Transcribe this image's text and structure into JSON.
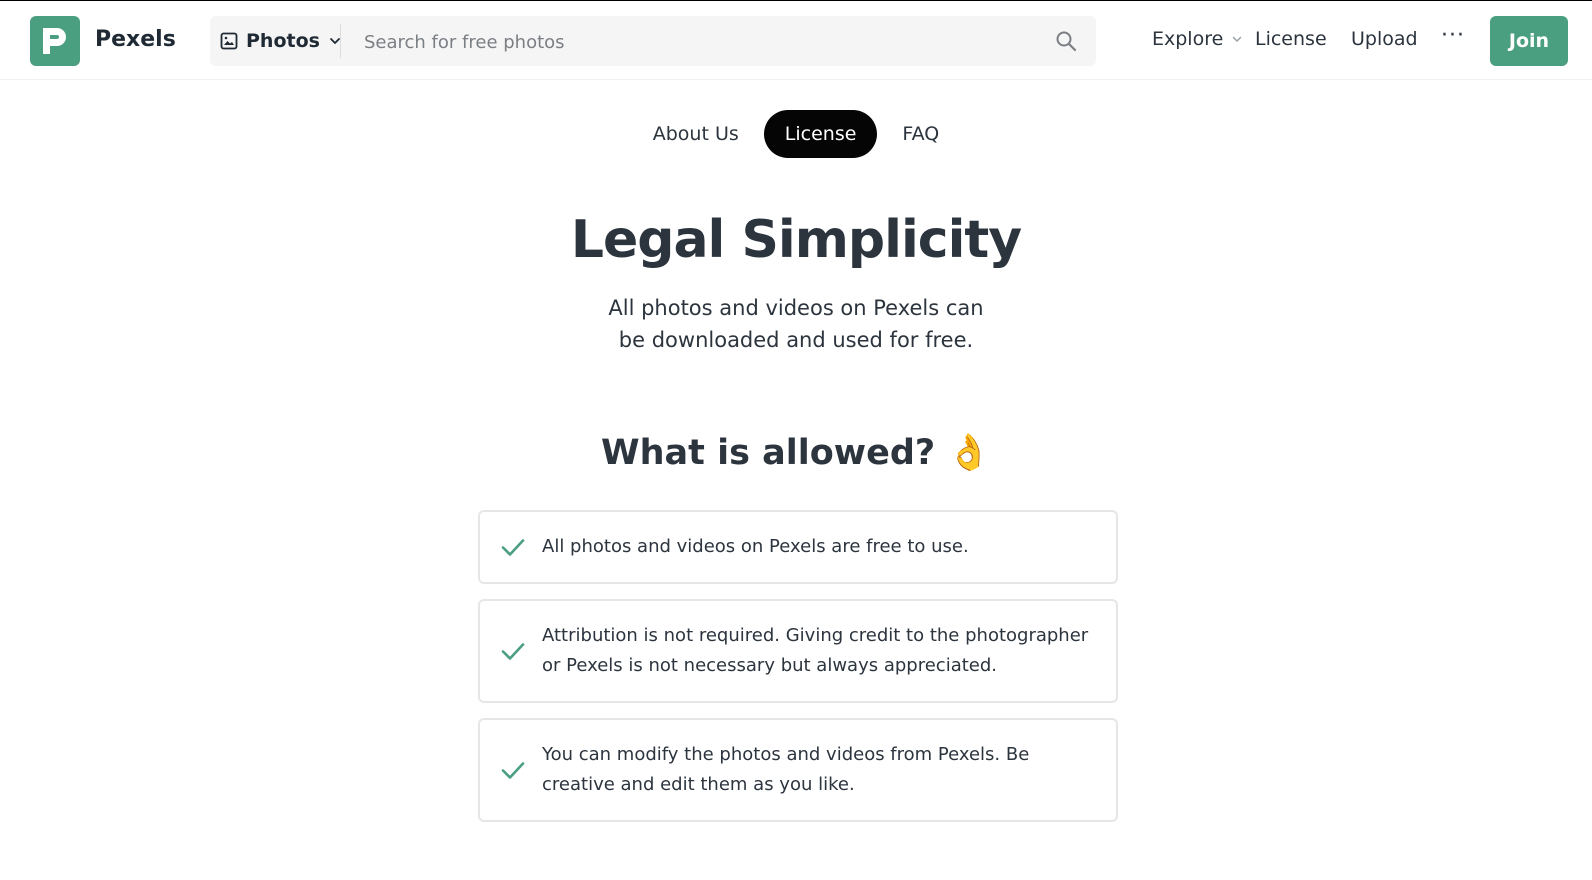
{
  "header": {
    "brand": "Pexels",
    "media_select": "Photos",
    "search_placeholder": "Search for free photos",
    "nav": {
      "explore": "Explore",
      "license": "License",
      "upload": "Upload",
      "more": "···",
      "join": "Join"
    }
  },
  "tabs": [
    {
      "label": "About Us",
      "active": false
    },
    {
      "label": "License",
      "active": true
    },
    {
      "label": "FAQ",
      "active": false
    }
  ],
  "hero": {
    "title": "Legal Simplicity",
    "subtitle": "All photos and videos on Pexels can be downloaded and used for free."
  },
  "allowed": {
    "title": "What is allowed? 👌",
    "items": [
      "All photos and videos on Pexels are free to use.",
      "Attribution is not required. Giving credit to the photographer or Pexels is not necessary but always appreciated.",
      "You can modify the photos and videos from Pexels. Be creative and edit them as you like."
    ]
  },
  "colors": {
    "brand_green": "#4a9f80",
    "active_tab": "#050505",
    "text": "#2c343e"
  }
}
